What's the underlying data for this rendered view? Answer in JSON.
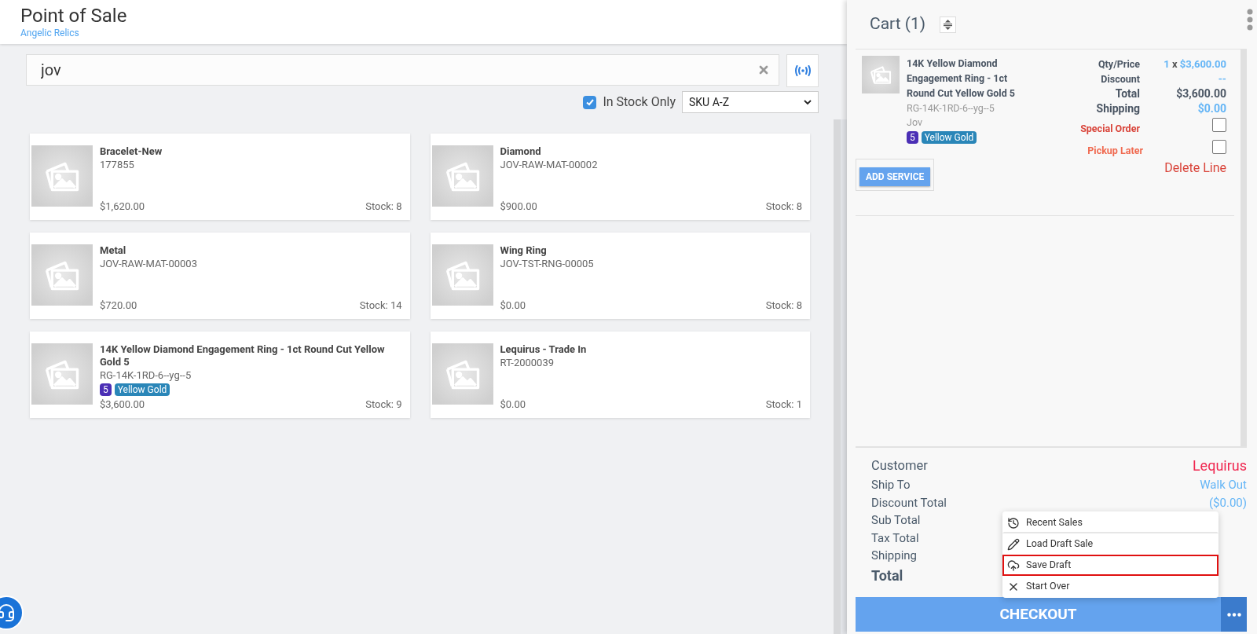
{
  "header": {
    "title": "Point of Sale",
    "subtitle": "Angelic Relics"
  },
  "search": {
    "value": "jov"
  },
  "filters": {
    "in_stock_only": {
      "label": "In Stock Only",
      "checked": true
    },
    "sort": {
      "value": "SKU A-Z"
    }
  },
  "products": [
    {
      "name": "Bracelet-New",
      "sku": "177855",
      "price": "$1,620.00",
      "stock": "Stock: 8"
    },
    {
      "name": "Diamond",
      "sku": "JOV-RAW-MAT-00002",
      "price": "$900.00",
      "stock": "Stock: 8"
    },
    {
      "name": "Metal",
      "sku": "JOV-RAW-MAT-00003",
      "price": "$720.00",
      "stock": "Stock: 14"
    },
    {
      "name": "Wing Ring",
      "sku": "JOV-TST-RNG-00005",
      "price": "$0.00",
      "stock": "Stock: 8"
    },
    {
      "name": "14K Yellow Diamond Engagement Ring - 1ct Round Cut Yellow Gold 5",
      "sku": "RG-14K-1RD-6--yg--5",
      "tags": [
        {
          "text": "5",
          "color": "#4b2fb5"
        },
        {
          "text": "Yellow Gold",
          "color": "#2a86b8"
        }
      ],
      "price": "$3,600.00",
      "stock": "Stock: 9"
    },
    {
      "name": "Lequirus - Trade In",
      "sku": "RT-2000039",
      "price": "$0.00",
      "stock": "Stock: 1"
    }
  ],
  "cart": {
    "title": "Cart (1)",
    "item": {
      "name": "14K Yellow Diamond Engagement Ring - 1ct Round Cut Yellow Gold 5",
      "sku": "RG-14K-1RD-6--yg--5",
      "vendor": "Jov",
      "tags": [
        {
          "text": "5",
          "color": "#4b2fb5"
        },
        {
          "text": "Yellow Gold",
          "color": "#2a86b8"
        }
      ],
      "qty_label": "Qty/Price",
      "qty": "1",
      "times": "x",
      "unit_price": "$3,600.00",
      "discount_label": "Discount",
      "discount": "--",
      "total_label": "Total",
      "total": "$3,600.00",
      "shipping_label": "Shipping",
      "shipping": "$0.00",
      "options": [
        {
          "label": "Special Order",
          "checked": false
        },
        {
          "label": "Pickup Later",
          "checked": false
        }
      ],
      "add_service": "ADD SERVICE",
      "delete": "Delete Line"
    },
    "summary": [
      {
        "kind": "line",
        "label": "Customer",
        "value": "Lequirus",
        "color": "#f0264f"
      },
      {
        "kind": "line",
        "label": "Ship To",
        "value": "Walk Out",
        "color": "#64b5f6"
      },
      {
        "kind": "line",
        "label": "Discount Total",
        "value": "($0.00)",
        "color": "#64b5f6"
      },
      {
        "kind": "line",
        "label": "Sub Total"
      },
      {
        "kind": "line",
        "label": "Tax Total"
      },
      {
        "kind": "line",
        "label": "Shipping"
      },
      {
        "kind": "total",
        "label": "Total"
      }
    ],
    "menu": [
      {
        "label": "Recent Sales",
        "selected": false
      },
      {
        "label": "Load Draft Sale",
        "selected": false
      },
      {
        "label": "Save Draft",
        "selected": true
      },
      {
        "label": "Start Over",
        "selected": false
      }
    ],
    "checkout": "CHECKOUT"
  }
}
